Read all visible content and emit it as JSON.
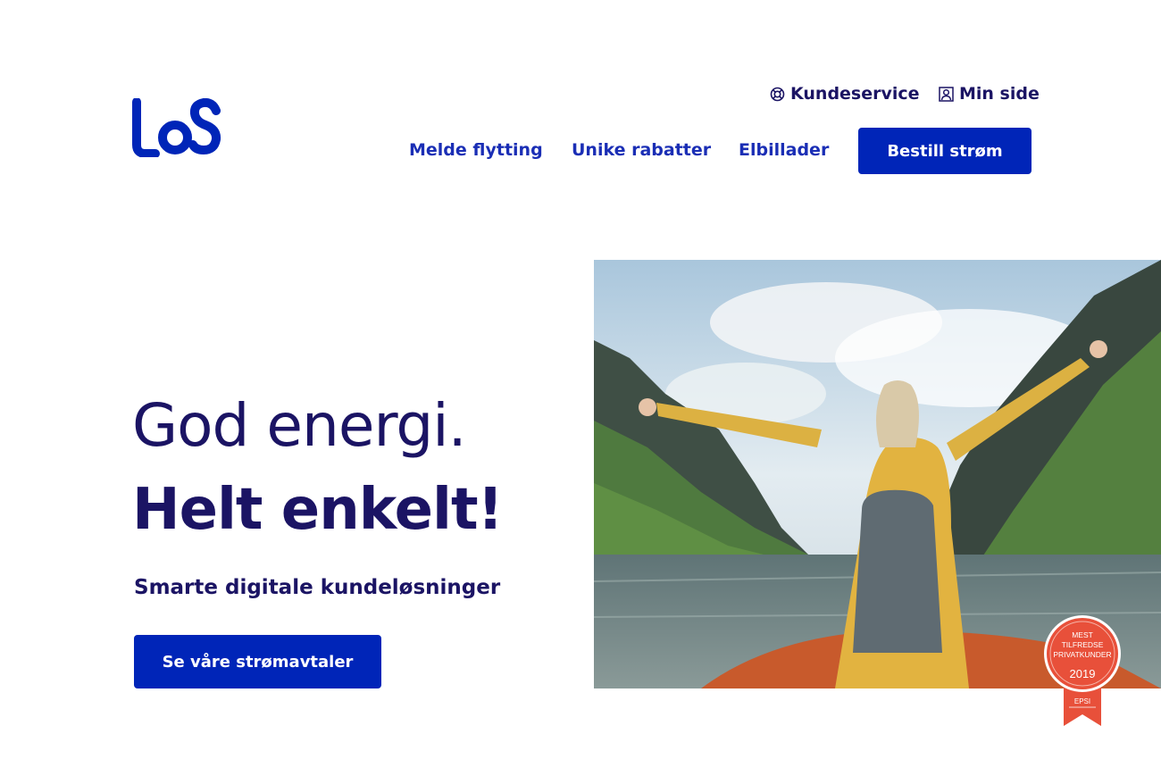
{
  "brand": {
    "logo_text": "LOS",
    "color": "#0025b8",
    "text_color": "#1b1464"
  },
  "utility_nav": {
    "customer_service": {
      "label": "Kundeservice",
      "icon": "lifebuoy-icon"
    },
    "my_page": {
      "label": "Min side",
      "icon": "user-icon"
    }
  },
  "main_nav": {
    "items": [
      {
        "label": "Melde flytting"
      },
      {
        "label": "Unike rabatter"
      },
      {
        "label": "Elbillader"
      }
    ],
    "cta_label": "Bestill strøm"
  },
  "hero": {
    "headline_1": "God energi.",
    "headline_2": "Helt enkelt!",
    "subheadline": "Smarte digitale kundeløsninger",
    "cta_label": "Se våre strømavtaler",
    "image_description": "hero-photo"
  },
  "award_badge": {
    "line1": "MEST",
    "line2": "TILFREDSE",
    "line3": "PRIVATKUNDER",
    "year": "2019",
    "source": "EPSI",
    "color": "#e8503a"
  }
}
